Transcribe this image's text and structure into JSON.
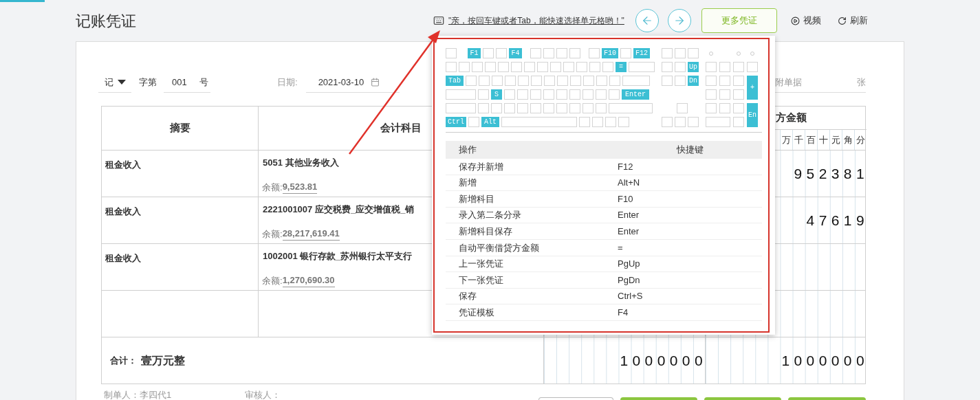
{
  "page_title": "记账凭证",
  "hint": "\"亲，按回车键或者Tab，能快速选择单元格哟！\"",
  "more_button": "更多凭证",
  "video": "视频",
  "refresh": "刷新",
  "voucher": {
    "type": "记",
    "word_label": "字第",
    "number": "001",
    "number_suffix": "号",
    "date_label": "日期:",
    "date": "2021-03-10",
    "attachments_label": "附单据",
    "attachments_unit": "张"
  },
  "table": {
    "columns": {
      "summary": "摘要",
      "account": "会计科目",
      "credit": "方金额"
    },
    "credit_digits": [
      "万",
      "千",
      "百",
      "十",
      "元",
      "角",
      "分"
    ],
    "rows": [
      {
        "summary": "租金收入",
        "account": "5051 其他业务收入",
        "balance_label": "余额:",
        "balance": "9,523.81",
        "credit": "952381"
      },
      {
        "summary": "租金收入",
        "account": "2221001007 应交税费_应交增值税_销",
        "balance_label": "余额:",
        "balance": "28,217,619.41",
        "credit": "47619"
      },
      {
        "summary": "租金收入",
        "account": "1002001 银行存款_苏州银行太平支行",
        "balance_label": "余额:",
        "balance": "1,270,690.30"
      }
    ],
    "total": {
      "label": "合计：",
      "amount_words": "壹万元整",
      "debit": "1000000",
      "credit": "1000000"
    }
  },
  "footer": {
    "preparer": "制单人：李四代1",
    "reviewer": "审核人："
  },
  "shortcuts": {
    "keys": [
      "F1",
      "F4",
      "F10",
      "F12",
      "=",
      "Up",
      "Tab",
      "Dn",
      "+",
      "S",
      "Enter",
      "En",
      "Ctrl",
      "Alt"
    ],
    "columns": [
      "操作",
      "快捷键"
    ],
    "rows": [
      {
        "action": "保存并新增",
        "key": "F12"
      },
      {
        "action": "新增",
        "key": "Alt+N"
      },
      {
        "action": "新增科目",
        "key": "F10"
      },
      {
        "action": "录入第二条分录",
        "key": "Enter"
      },
      {
        "action": "新增科目保存",
        "key": "Enter"
      },
      {
        "action": "自动平衡借贷方金额",
        "key": "="
      },
      {
        "action": "上一张凭证",
        "key": "PgUp"
      },
      {
        "action": "下一张凭证",
        "key": "PgDn"
      },
      {
        "action": "保存",
        "key": "Ctrl+S"
      },
      {
        "action": "凭证模板",
        "key": "F4"
      }
    ]
  }
}
